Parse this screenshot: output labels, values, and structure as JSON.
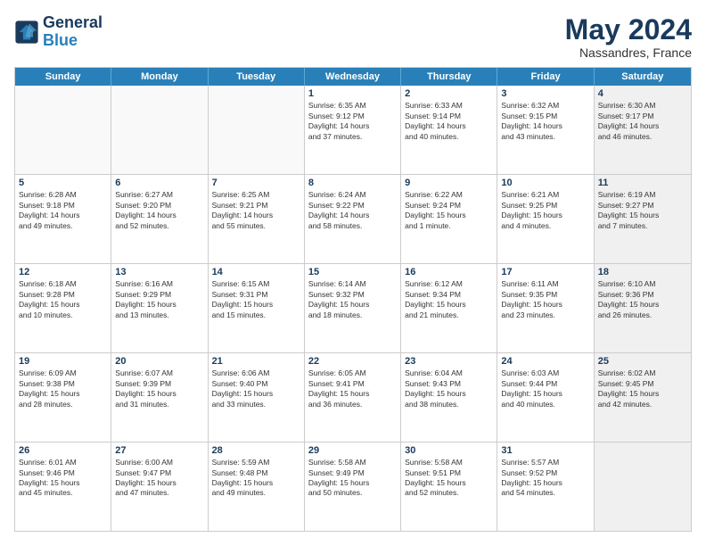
{
  "logo": {
    "line1": "General",
    "line2": "Blue"
  },
  "title": "May 2024",
  "subtitle": "Nassandres, France",
  "header_days": [
    "Sunday",
    "Monday",
    "Tuesday",
    "Wednesday",
    "Thursday",
    "Friday",
    "Saturday"
  ],
  "rows": [
    [
      {
        "day": "",
        "text": "",
        "empty": true
      },
      {
        "day": "",
        "text": "",
        "empty": true
      },
      {
        "day": "",
        "text": "",
        "empty": true
      },
      {
        "day": "1",
        "text": "Sunrise: 6:35 AM\nSunset: 9:12 PM\nDaylight: 14 hours\nand 37 minutes."
      },
      {
        "day": "2",
        "text": "Sunrise: 6:33 AM\nSunset: 9:14 PM\nDaylight: 14 hours\nand 40 minutes."
      },
      {
        "day": "3",
        "text": "Sunrise: 6:32 AM\nSunset: 9:15 PM\nDaylight: 14 hours\nand 43 minutes."
      },
      {
        "day": "4",
        "text": "Sunrise: 6:30 AM\nSunset: 9:17 PM\nDaylight: 14 hours\nand 46 minutes.",
        "shaded": true
      }
    ],
    [
      {
        "day": "5",
        "text": "Sunrise: 6:28 AM\nSunset: 9:18 PM\nDaylight: 14 hours\nand 49 minutes."
      },
      {
        "day": "6",
        "text": "Sunrise: 6:27 AM\nSunset: 9:20 PM\nDaylight: 14 hours\nand 52 minutes."
      },
      {
        "day": "7",
        "text": "Sunrise: 6:25 AM\nSunset: 9:21 PM\nDaylight: 14 hours\nand 55 minutes."
      },
      {
        "day": "8",
        "text": "Sunrise: 6:24 AM\nSunset: 9:22 PM\nDaylight: 14 hours\nand 58 minutes."
      },
      {
        "day": "9",
        "text": "Sunrise: 6:22 AM\nSunset: 9:24 PM\nDaylight: 15 hours\nand 1 minute."
      },
      {
        "day": "10",
        "text": "Sunrise: 6:21 AM\nSunset: 9:25 PM\nDaylight: 15 hours\nand 4 minutes."
      },
      {
        "day": "11",
        "text": "Sunrise: 6:19 AM\nSunset: 9:27 PM\nDaylight: 15 hours\nand 7 minutes.",
        "shaded": true
      }
    ],
    [
      {
        "day": "12",
        "text": "Sunrise: 6:18 AM\nSunset: 9:28 PM\nDaylight: 15 hours\nand 10 minutes."
      },
      {
        "day": "13",
        "text": "Sunrise: 6:16 AM\nSunset: 9:29 PM\nDaylight: 15 hours\nand 13 minutes."
      },
      {
        "day": "14",
        "text": "Sunrise: 6:15 AM\nSunset: 9:31 PM\nDaylight: 15 hours\nand 15 minutes."
      },
      {
        "day": "15",
        "text": "Sunrise: 6:14 AM\nSunset: 9:32 PM\nDaylight: 15 hours\nand 18 minutes."
      },
      {
        "day": "16",
        "text": "Sunrise: 6:12 AM\nSunset: 9:34 PM\nDaylight: 15 hours\nand 21 minutes."
      },
      {
        "day": "17",
        "text": "Sunrise: 6:11 AM\nSunset: 9:35 PM\nDaylight: 15 hours\nand 23 minutes."
      },
      {
        "day": "18",
        "text": "Sunrise: 6:10 AM\nSunset: 9:36 PM\nDaylight: 15 hours\nand 26 minutes.",
        "shaded": true
      }
    ],
    [
      {
        "day": "19",
        "text": "Sunrise: 6:09 AM\nSunset: 9:38 PM\nDaylight: 15 hours\nand 28 minutes."
      },
      {
        "day": "20",
        "text": "Sunrise: 6:07 AM\nSunset: 9:39 PM\nDaylight: 15 hours\nand 31 minutes."
      },
      {
        "day": "21",
        "text": "Sunrise: 6:06 AM\nSunset: 9:40 PM\nDaylight: 15 hours\nand 33 minutes."
      },
      {
        "day": "22",
        "text": "Sunrise: 6:05 AM\nSunset: 9:41 PM\nDaylight: 15 hours\nand 36 minutes."
      },
      {
        "day": "23",
        "text": "Sunrise: 6:04 AM\nSunset: 9:43 PM\nDaylight: 15 hours\nand 38 minutes."
      },
      {
        "day": "24",
        "text": "Sunrise: 6:03 AM\nSunset: 9:44 PM\nDaylight: 15 hours\nand 40 minutes."
      },
      {
        "day": "25",
        "text": "Sunrise: 6:02 AM\nSunset: 9:45 PM\nDaylight: 15 hours\nand 42 minutes.",
        "shaded": true
      }
    ],
    [
      {
        "day": "26",
        "text": "Sunrise: 6:01 AM\nSunset: 9:46 PM\nDaylight: 15 hours\nand 45 minutes."
      },
      {
        "day": "27",
        "text": "Sunrise: 6:00 AM\nSunset: 9:47 PM\nDaylight: 15 hours\nand 47 minutes."
      },
      {
        "day": "28",
        "text": "Sunrise: 5:59 AM\nSunset: 9:48 PM\nDaylight: 15 hours\nand 49 minutes."
      },
      {
        "day": "29",
        "text": "Sunrise: 5:58 AM\nSunset: 9:49 PM\nDaylight: 15 hours\nand 50 minutes."
      },
      {
        "day": "30",
        "text": "Sunrise: 5:58 AM\nSunset: 9:51 PM\nDaylight: 15 hours\nand 52 minutes."
      },
      {
        "day": "31",
        "text": "Sunrise: 5:57 AM\nSunset: 9:52 PM\nDaylight: 15 hours\nand 54 minutes."
      },
      {
        "day": "",
        "text": "",
        "empty": true,
        "shaded": true
      }
    ]
  ]
}
